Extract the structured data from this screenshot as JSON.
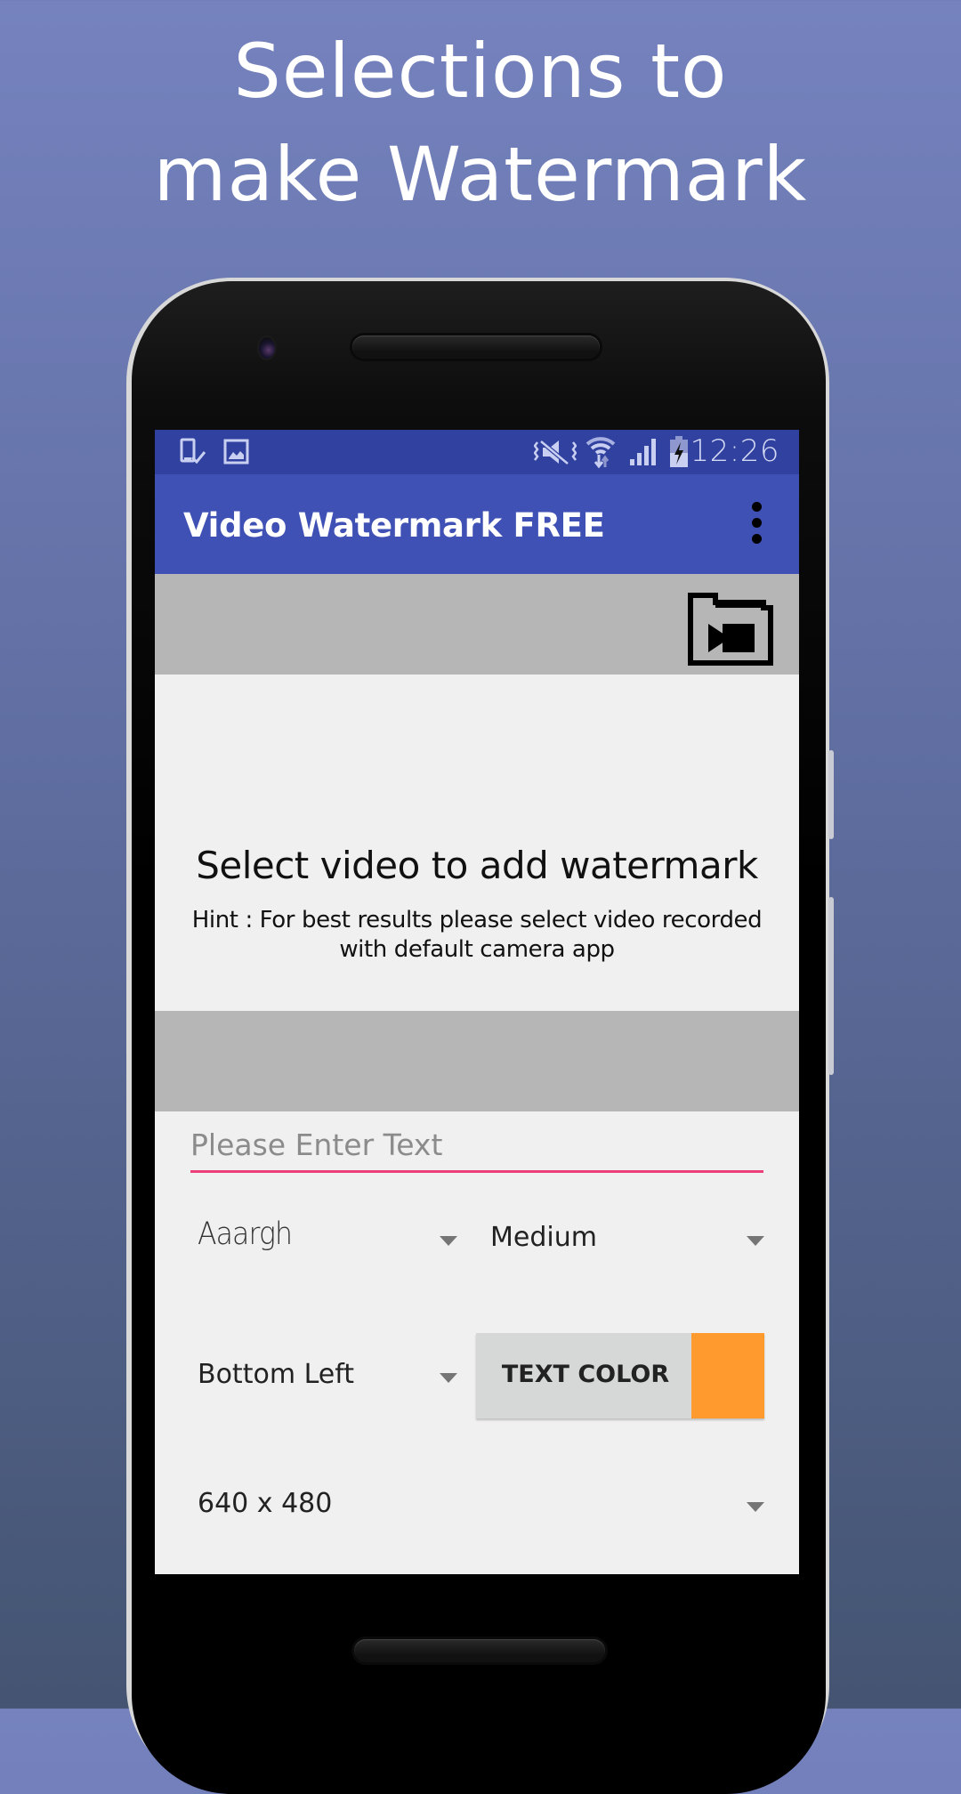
{
  "headline": {
    "line1": "Selections to",
    "line2": "make Watermark"
  },
  "status_bar": {
    "left_icons": [
      "screenshot-saved-icon",
      "image-notification-icon"
    ],
    "right_icons": [
      "vibrate-mute-icon",
      "wifi-icon",
      "cell-signal-icon",
      "battery-charging-icon"
    ],
    "time": "12:26"
  },
  "app_bar": {
    "title": "Video Watermark FREE",
    "overflow_icon": "more-vert-icon"
  },
  "video_picker": {
    "icon": "video-folder-icon",
    "title": "Select video to add watermark",
    "hint": "Hint : For best results please select video recorded with default camera app"
  },
  "form": {
    "text_input": {
      "value": "",
      "placeholder": "Please Enter Text"
    },
    "font_spinner": {
      "selected": "Aaargh"
    },
    "size_spinner": {
      "selected": "Medium"
    },
    "position_spinner": {
      "selected": "Bottom Left"
    },
    "text_color_button": {
      "label": "TEXT COLOR",
      "swatch_color": "#ff9a2e"
    },
    "resolution_spinner": {
      "selected": "640 x 480"
    }
  },
  "colors": {
    "primary": "#3f51b5",
    "primary_dark": "#3041a0",
    "accent": "#ec407a",
    "band_gray": "#b7b6b7",
    "screen_bg": "#f0f0f0"
  }
}
